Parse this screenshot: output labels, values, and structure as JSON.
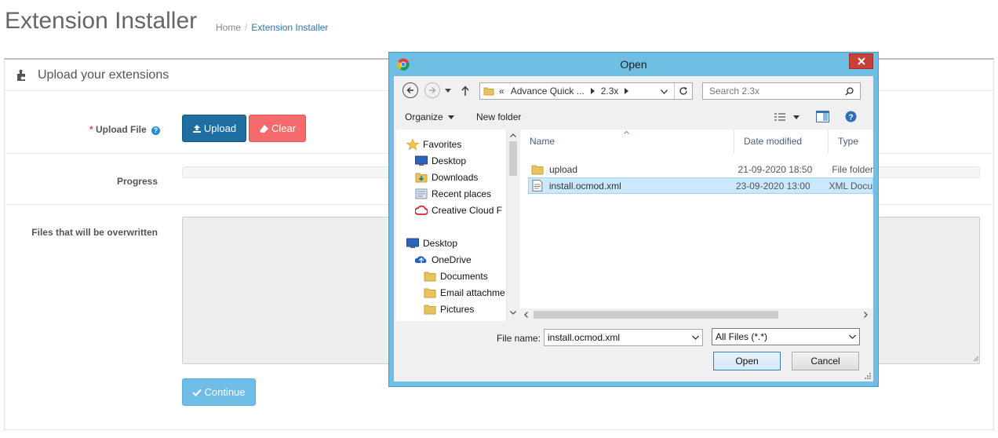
{
  "header": {
    "title": "Extension Installer",
    "breadcrumb": {
      "home": "Home",
      "separator": "/",
      "current": "Extension Installer"
    }
  },
  "panel": {
    "heading": "Upload your extensions",
    "upload_file": {
      "required_mark": "*",
      "label": "Upload File",
      "help_icon": "question-circle-icon"
    },
    "upload_button": "Upload",
    "clear_button": "Clear",
    "progress_label": "Progress",
    "progress_value": 0,
    "overwrite_label": "Files that will be overwritten",
    "overwrite_value": "",
    "continue_button": "Continue"
  },
  "dialog": {
    "title": "Open",
    "address": {
      "prefix": "«",
      "segment1": "Advance Quick ...",
      "segment2": "2.3x"
    },
    "search_placeholder": "Search 2.3x",
    "organize": "Organize",
    "new_folder": "New folder",
    "nav": {
      "favorites": "Favorites",
      "items": [
        "Desktop",
        "Downloads",
        "Recent places",
        "Creative Cloud F"
      ],
      "desktop": "Desktop",
      "onedrive": "OneDrive",
      "onedrive_items": [
        "Documents",
        "Email attachme",
        "Pictures"
      ]
    },
    "columns": {
      "name": "Name",
      "date": "Date modified",
      "type": "Type"
    },
    "files": [
      {
        "name": "upload",
        "date": "21-09-2020 18:50",
        "type": "File folder",
        "selected": false
      },
      {
        "name": "install.ocmod.xml",
        "date": "23-09-2020 13:00",
        "type": "XML Docu",
        "selected": true
      }
    ],
    "file_name_label": "File name:",
    "file_name_value": "install.ocmod.xml",
    "file_type": "All Files (*.*)",
    "open_button": "Open",
    "cancel_button": "Cancel"
  },
  "colors": {
    "primary": "#1f6ea2",
    "danger": "#f56b6b",
    "info": "#6fbde7",
    "dialog_frame": "#6ebfe3",
    "close": "#c8403b",
    "selection": "#cce8ff"
  }
}
